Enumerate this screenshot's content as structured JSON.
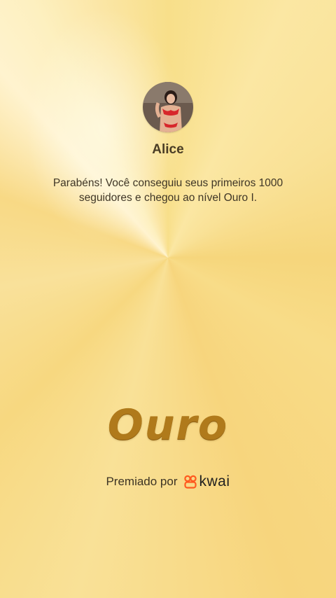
{
  "profile": {
    "name": "Alice",
    "avatar_icon": "user-avatar-photo"
  },
  "message": "Parabéns! Você conseguiu seus primeiros 1000 seguidores e chegou ao nível Ouro I.",
  "level": {
    "title": "Ouro"
  },
  "awarded": {
    "label": "Premiado por",
    "brand": "kwai",
    "brand_icon": "kwai-logo-icon",
    "brand_color": "#ff5a1f"
  },
  "colors": {
    "background": "#f8dc88",
    "level_text": "#b07a1b"
  }
}
